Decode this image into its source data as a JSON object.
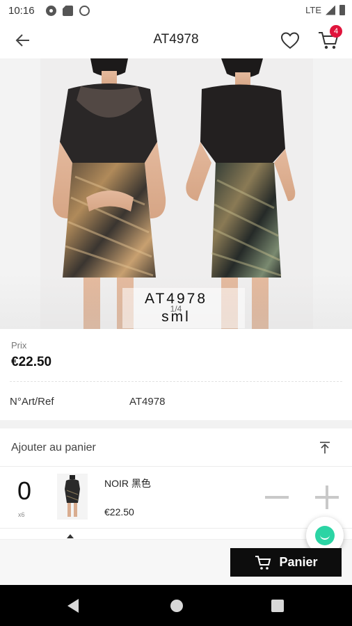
{
  "status_bar": {
    "time": "10:16",
    "network": "LTE"
  },
  "header": {
    "title": "AT4978",
    "cart_count": "4"
  },
  "gallery": {
    "caption_code": "AT4978",
    "counter": "1/4",
    "caption_size": "sml"
  },
  "price": {
    "label": "Prix",
    "value": "€22.50"
  },
  "reference": {
    "label": "N°Art/Ref",
    "value": "AT4978"
  },
  "add_to_cart": {
    "label": "Ajouter au panier"
  },
  "variant": {
    "quantity": "0",
    "unit": "x6",
    "name": "NOIR 黑色",
    "price": "€22.50"
  },
  "cart_button": {
    "label": "Panier"
  },
  "colors": {
    "accent": "#0d0d0d",
    "badge": "#e0143c",
    "chat": "#2bd4a4"
  },
  "icons": [
    "back-arrow-icon",
    "heart-icon",
    "cart-icon",
    "collapse-top-icon",
    "minus-icon",
    "plus-icon",
    "chat-icon"
  ]
}
